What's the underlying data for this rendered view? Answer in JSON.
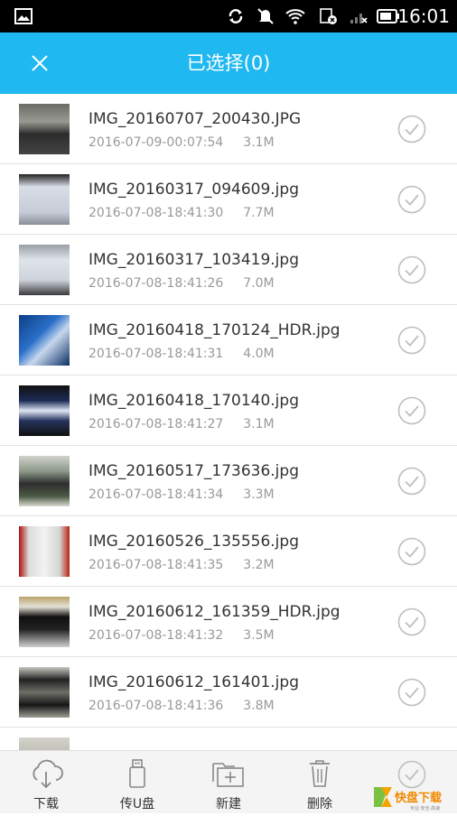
{
  "status_bar": {
    "time": "16:01"
  },
  "header": {
    "title": "已选择(0)"
  },
  "files": [
    {
      "name": "IMG_20160707_200430.JPG",
      "date": "2016-07-09-00:07:54",
      "size": "3.1M"
    },
    {
      "name": "IMG_20160317_094609.jpg",
      "date": "2016-07-08-18:41:30",
      "size": "7.7M"
    },
    {
      "name": "IMG_20160317_103419.jpg",
      "date": "2016-07-08-18:41:26",
      "size": "7.0M"
    },
    {
      "name": "IMG_20160418_170124_HDR.jpg",
      "date": "2016-07-08-18:41:31",
      "size": "4.0M"
    },
    {
      "name": "IMG_20160418_170140.jpg",
      "date": "2016-07-08-18:41:27",
      "size": "3.1M"
    },
    {
      "name": "IMG_20160517_173636.jpg",
      "date": "2016-07-08-18:41:34",
      "size": "3.3M"
    },
    {
      "name": "IMG_20160526_135556.jpg",
      "date": "2016-07-08-18:41:35",
      "size": "3.2M"
    },
    {
      "name": "IMG_20160612_161359_HDR.jpg",
      "date": "2016-07-08-18:41:32",
      "size": "3.5M"
    },
    {
      "name": "IMG_20160612_161401.jpg",
      "date": "2016-07-08-18:41:36",
      "size": "3.8M"
    }
  ],
  "bottom_bar": {
    "download_label": "下载",
    "upload_usb_label": "传U盘",
    "new_label": "新建",
    "delete_label": "删除"
  },
  "watermark": {
    "brand": "快盘下载"
  },
  "colors": {
    "accent": "#20b8f0",
    "check": "#bfbfbf"
  }
}
